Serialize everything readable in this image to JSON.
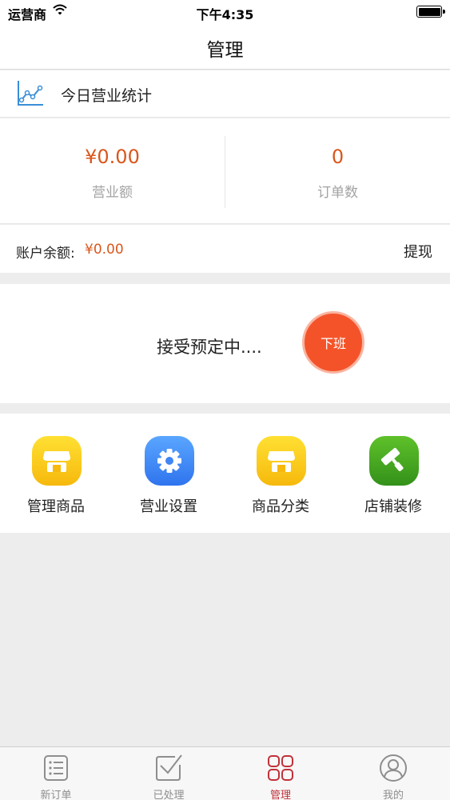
{
  "status_bar": {
    "carrier": "运营商",
    "time": "下午4:35"
  },
  "nav": {
    "title": "管理"
  },
  "stats": {
    "header": "今日营业统计",
    "revenue_value": "¥0.00",
    "revenue_label": "营业额",
    "orders_value": "0",
    "orders_label": "订单数"
  },
  "balance": {
    "label": "账户余额:",
    "value": "¥0.00",
    "withdraw": "提现"
  },
  "shift": {
    "status": "接受预定中....",
    "button": "下班"
  },
  "functions": [
    {
      "label": "管理商品",
      "icon": "store-icon",
      "color": "#f6b90c"
    },
    {
      "label": "营业设置",
      "icon": "gear-icon",
      "color": "#2f74ee"
    },
    {
      "label": "商品分类",
      "icon": "store-icon",
      "color": "#f6b90c"
    },
    {
      "label": "店铺装修",
      "icon": "paint-roller-icon",
      "color": "#33911a"
    }
  ],
  "tabs": [
    {
      "label": "新订单",
      "icon": "list-icon",
      "active": false
    },
    {
      "label": "已处理",
      "icon": "checked-box-icon",
      "active": false
    },
    {
      "label": "管理",
      "icon": "grid-icon",
      "active": true
    },
    {
      "label": "我的",
      "icon": "user-icon",
      "active": false
    }
  ],
  "colors": {
    "accent": "#d9571c",
    "off_duty_button": "#f4532a",
    "active_tab": "#c1313a"
  }
}
